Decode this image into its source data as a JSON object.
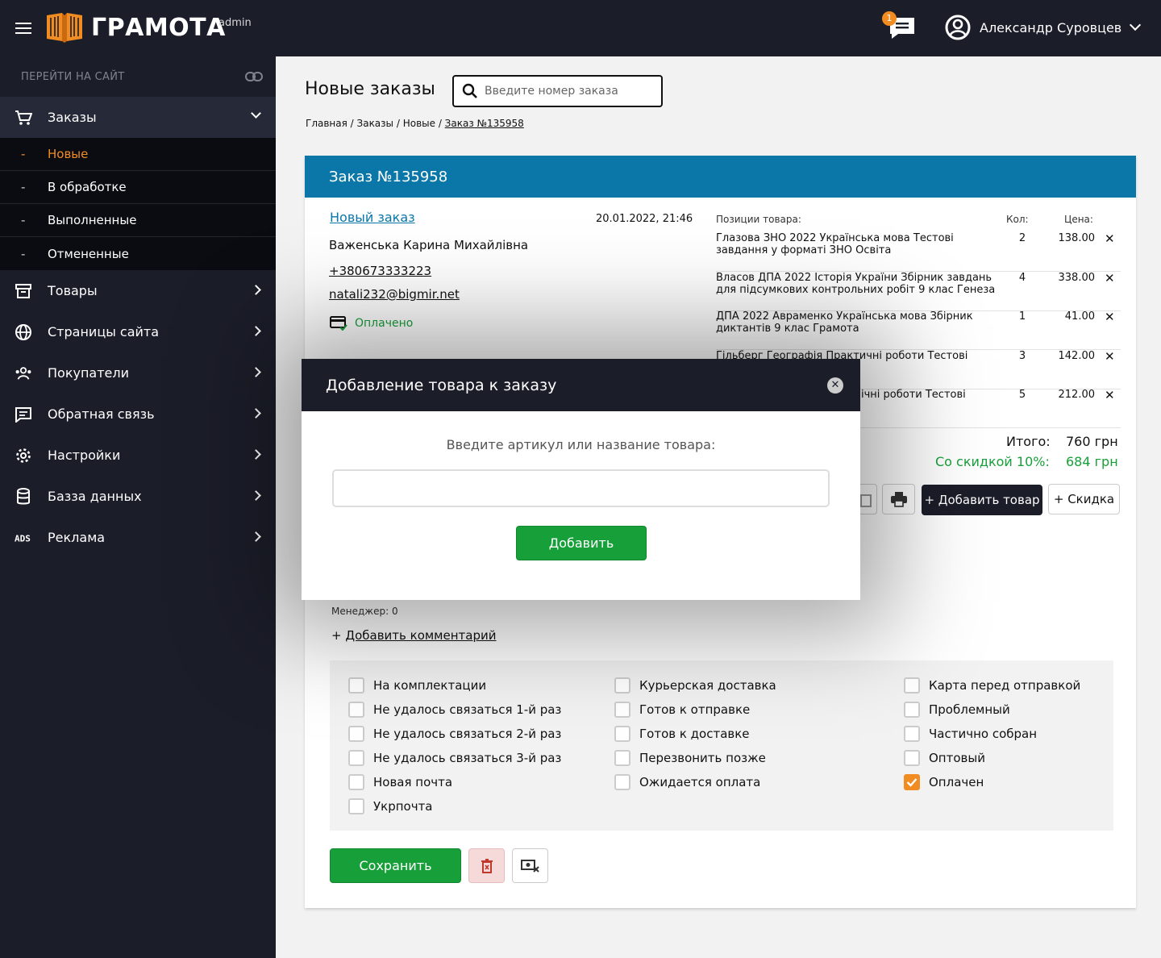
{
  "brand": {
    "name": "ГРАМОТА",
    "suffix": "admin"
  },
  "header": {
    "chat_badge": "1",
    "user_name": "Александр Суровцев"
  },
  "sidebar": {
    "goto_label": "ПЕРЕЙТИ НА САЙТ",
    "orders": {
      "label": "Заказы",
      "sub": [
        "Новые",
        "В обработке",
        "Выполненные",
        "Отмененные"
      ]
    },
    "items": [
      "Товары",
      "Страницы сайта",
      "Покупатели",
      "Обратная связь",
      "Настройки",
      "Базза данных",
      "Реклама"
    ]
  },
  "page": {
    "title": "Новые заказы",
    "search_placeholder": "Введите номер заказа",
    "breadcrumb": {
      "b1": "Главная",
      "b2": "Заказы",
      "b3": "Новые",
      "b4": "Заказ №135958"
    }
  },
  "order": {
    "title": "Заказ №135958",
    "status": "Новый заказ",
    "datetime": "20.01.2022, 21:46",
    "customer": "Важенська Карина Михайлівна",
    "phone": "+380673333223",
    "email": "natali232@bigmir.net",
    "payment": "Оплачено",
    "items_header": {
      "name": "Позиции товара:",
      "qty": "Кол:",
      "price": "Цена:"
    },
    "items": [
      {
        "name": "Глазова ЗНО 2022 Українська мова Тестові завдання у форматі ЗНО Освіта",
        "qty": "2",
        "price": "138.00"
      },
      {
        "name": "Власов ДПА 2022 Історія України Збірник завдань для підсумкових контрольних робіт 9 клас Генеза",
        "qty": "4",
        "price": "338.00"
      },
      {
        "name": "ДПА 2022 Авраменко Українська мова Збірник диктантів 9 клас Грамота",
        "qty": "1",
        "price": "41.00"
      },
      {
        "name": "Гільберг Географія Практичні роботи Тестові",
        "qty": "3",
        "price": "142.00"
      },
      {
        "name": "ічні роботи Тестові",
        "qty": "5",
        "price": "212.00"
      }
    ],
    "remove_glyph": "✕",
    "total_label": "Итого:",
    "total_value": "760 грн",
    "discount_label": "Со скидкой 10%:",
    "discount_value": "684 грн",
    "add_product_label": "+ Добавить товар",
    "discount_button_label": "+ Скидка",
    "manager_label": "Менеджер:",
    "manager_value": "0",
    "add_comment_prefix": "+",
    "add_comment_label": "Добавить комментарий",
    "save_label": "Сохранить"
  },
  "flags": [
    {
      "label": "На комплектации",
      "checked": false
    },
    {
      "label": "Не удалось связаться 1-й раз",
      "checked": false
    },
    {
      "label": "Не удалось связаться 2-й раз",
      "checked": false
    },
    {
      "label": "Не удалось связаться 3-й раз",
      "checked": false
    },
    {
      "label": "Новая почта",
      "checked": false
    },
    {
      "label": "Укрпочта",
      "checked": false
    },
    {
      "label": "Курьерская доставка",
      "checked": false
    },
    {
      "label": "Готов к отправке",
      "checked": false
    },
    {
      "label": "Готов к доставке",
      "checked": false
    },
    {
      "label": "Перезвонить позже",
      "checked": false
    },
    {
      "label": "Ожидается оплата",
      "checked": false
    },
    {
      "label": "Карта перед отправкой",
      "checked": false
    },
    {
      "label": "Проблемный",
      "checked": false
    },
    {
      "label": "Частично собран",
      "checked": false
    },
    {
      "label": "Оптовый",
      "checked": false
    },
    {
      "label": "Оплачен",
      "checked": true
    }
  ],
  "modal": {
    "title": "Добавление товара к заказу",
    "close_glyph": "✕",
    "label": "Введите артикул или название товара:",
    "input_value": "",
    "button_label": "Добавить"
  },
  "colors": {
    "dark": "#1b1d29",
    "accent": "#f08c22",
    "blue": "#0a77a8",
    "green": "#17a03a"
  }
}
